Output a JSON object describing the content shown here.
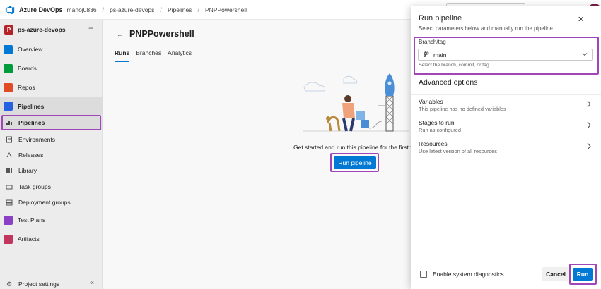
{
  "header": {
    "brand": "Azure DevOps",
    "breadcrumbs": [
      "manoj0836",
      "ps-azure-devops",
      "Pipelines",
      "PNPPowershell"
    ],
    "separator": "/"
  },
  "sidebar": {
    "project_initial": "P",
    "project_name": "ps-azure-devops",
    "add_glyph": "+",
    "items": [
      {
        "label": "Overview",
        "icon": "overview-icon"
      },
      {
        "label": "Boards",
        "icon": "boards-icon"
      },
      {
        "label": "Repos",
        "icon": "repos-icon"
      },
      {
        "label": "Pipelines",
        "icon": "pipelines-icon"
      },
      {
        "label": "Pipelines",
        "icon": "pipelines-sub-icon"
      },
      {
        "label": "Environments",
        "icon": "environments-icon"
      },
      {
        "label": "Releases",
        "icon": "releases-icon"
      },
      {
        "label": "Library",
        "icon": "library-icon"
      },
      {
        "label": "Task groups",
        "icon": "task-groups-icon"
      },
      {
        "label": "Deployment groups",
        "icon": "deployment-groups-icon"
      },
      {
        "label": "Test Plans",
        "icon": "test-plans-icon"
      },
      {
        "label": "Artifacts",
        "icon": "artifacts-icon"
      }
    ],
    "settings_label": "Project settings",
    "collapse_glyph": "«"
  },
  "main": {
    "title": "PNPPowershell",
    "back_glyph": "←",
    "tabs": [
      {
        "label": "Runs",
        "active": true
      },
      {
        "label": "Branches",
        "active": false
      },
      {
        "label": "Analytics",
        "active": false
      }
    ],
    "empty_text": "Get started and run this pipeline for the first tim",
    "run_pipeline_label": "Run pipeline"
  },
  "panel": {
    "title": "Run pipeline",
    "subtitle": "Select parameters below and manually run the pipeline",
    "close_glyph": "✕",
    "branch_label": "Branch/tag",
    "branch_value": "main",
    "branch_hint": "Select the branch, commit, or tag",
    "advanced_title": "Advanced options",
    "options": [
      {
        "title": "Variables",
        "desc": "This pipeline has no defined variables"
      },
      {
        "title": "Stages to run",
        "desc": "Run as configured"
      },
      {
        "title": "Resources",
        "desc": "Use latest version of all resources"
      }
    ],
    "diagnostics_label": "Enable system diagnostics",
    "diagnostics_checked": false,
    "cancel_label": "Cancel",
    "run_label": "Run"
  },
  "colors": {
    "accent": "#0078d4",
    "highlight": "#a146b8",
    "project_badge": "#b4232a"
  }
}
